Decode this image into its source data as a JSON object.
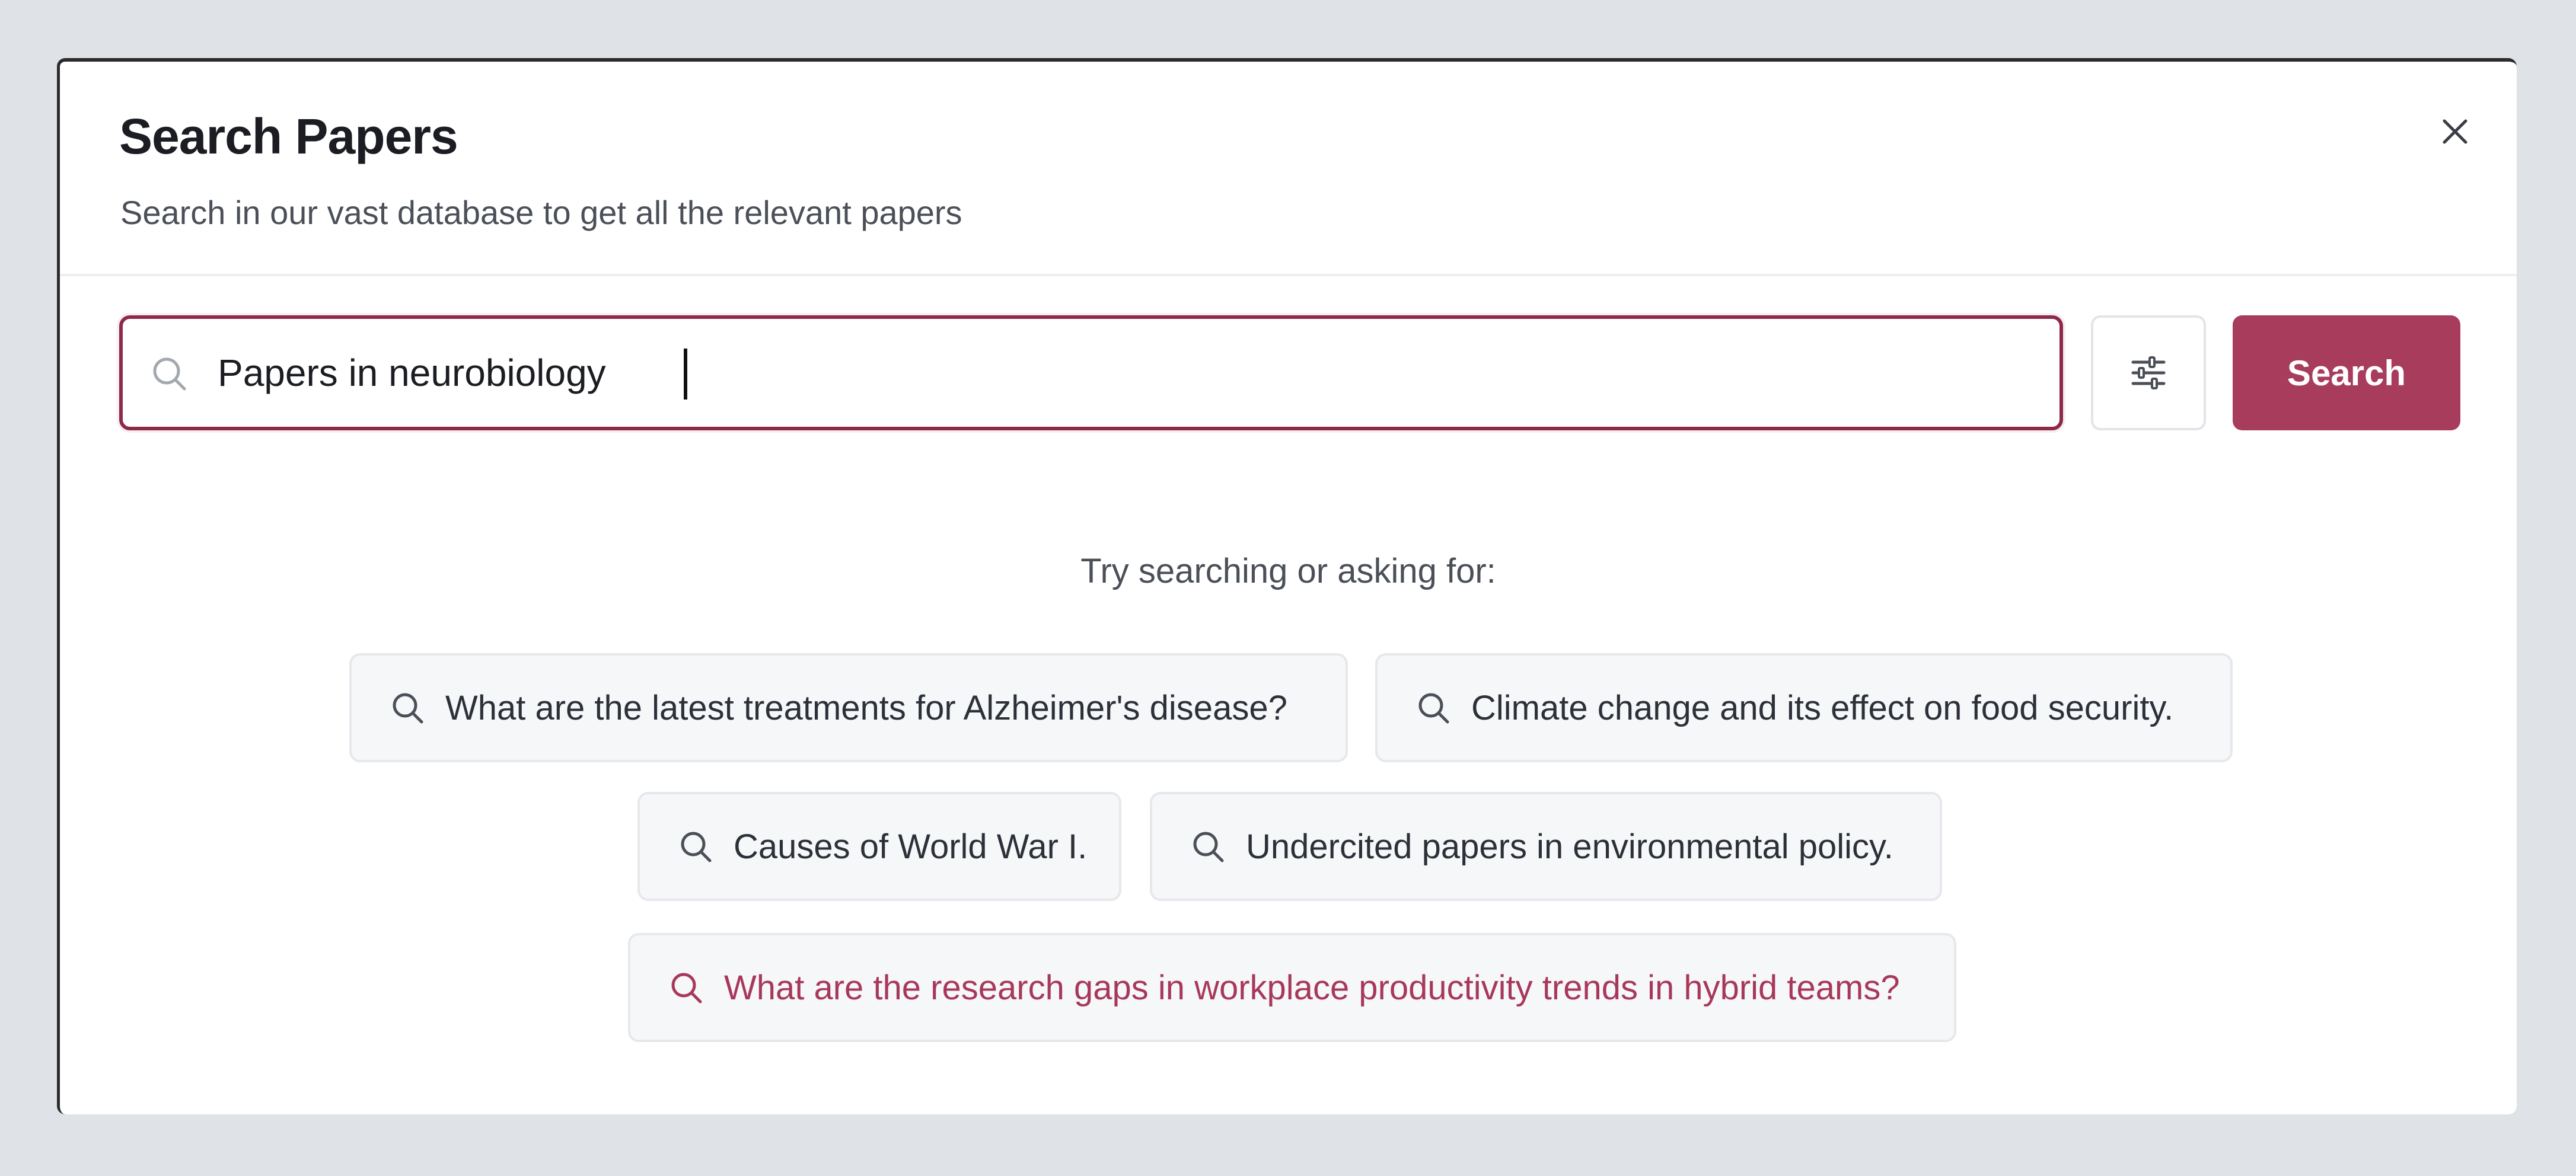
{
  "modal": {
    "title": "Search Papers",
    "subtitle": "Search in our vast database to get all the relevant papers",
    "close_icon": "close-icon"
  },
  "search": {
    "value": "Papers in neurobiology",
    "icon": "search-icon",
    "filter_icon": "sliders-icon",
    "button_label": "Search",
    "accent_color": "#a83c5c",
    "border_color": "#8d2a48"
  },
  "suggestions": {
    "heading": "Try searching or asking for:",
    "items": [
      {
        "label": "What are the latest treatments for Alzheimer's disease?"
      },
      {
        "label": "Climate change and its effect on food security."
      },
      {
        "label": "Causes of World War I."
      },
      {
        "label": "Undercited papers in environmental policy."
      },
      {
        "label": "What are the research gaps in workplace productivity trends in hybrid teams?",
        "highlighted": true
      }
    ],
    "highlight_color": "#a8385a"
  }
}
